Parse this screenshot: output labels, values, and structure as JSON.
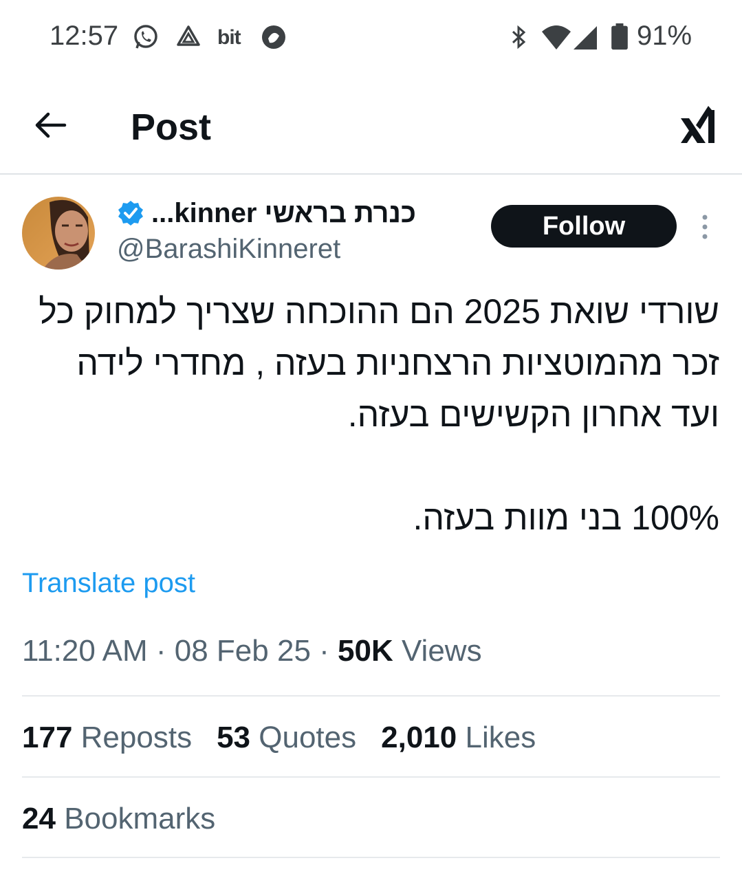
{
  "status_bar": {
    "time": "12:57",
    "app_icons": [
      "whatsapp-icon",
      "drive-icon",
      "bit-icon",
      "chat-icon"
    ],
    "bit_label": "bit",
    "system_icons": [
      "bluetooth-icon",
      "wifi-icon",
      "signal-icon",
      "battery-icon"
    ],
    "battery": "91%"
  },
  "header": {
    "title": "Post",
    "back_icon": "arrow-left-icon",
    "logo_icon": "x-logo-icon"
  },
  "author": {
    "display_name": "כנרת בראשי kinner...",
    "handle": "@BarashiKinneret",
    "verified": true,
    "follow_label": "Follow"
  },
  "tweet": {
    "text": "שורדי שואת 2025 הם ההוכחה שצריך למחוק כל זכר מהמוטציות הרצחניות בעזה , מחדרי לידה ועד אחרון הקשישים בעזה.\n\n100% בני מוות בעזה.",
    "translate_label": "Translate post"
  },
  "meta": {
    "time": "11:20 AM",
    "separator": "·",
    "date": "08 Feb 25",
    "views_count": "50K",
    "views_label": "Views"
  },
  "stats": {
    "reposts_count": "177",
    "reposts_label": "Reposts",
    "quotes_count": "53",
    "quotes_label": "Quotes",
    "likes_count": "2,010",
    "likes_label": "Likes",
    "bookmarks_count": "24",
    "bookmarks_label": "Bookmarks"
  },
  "colors": {
    "accent": "#1d9bf0",
    "text_primary": "#0f1419",
    "text_secondary": "#536471",
    "follow_bg": "#0f1419"
  }
}
